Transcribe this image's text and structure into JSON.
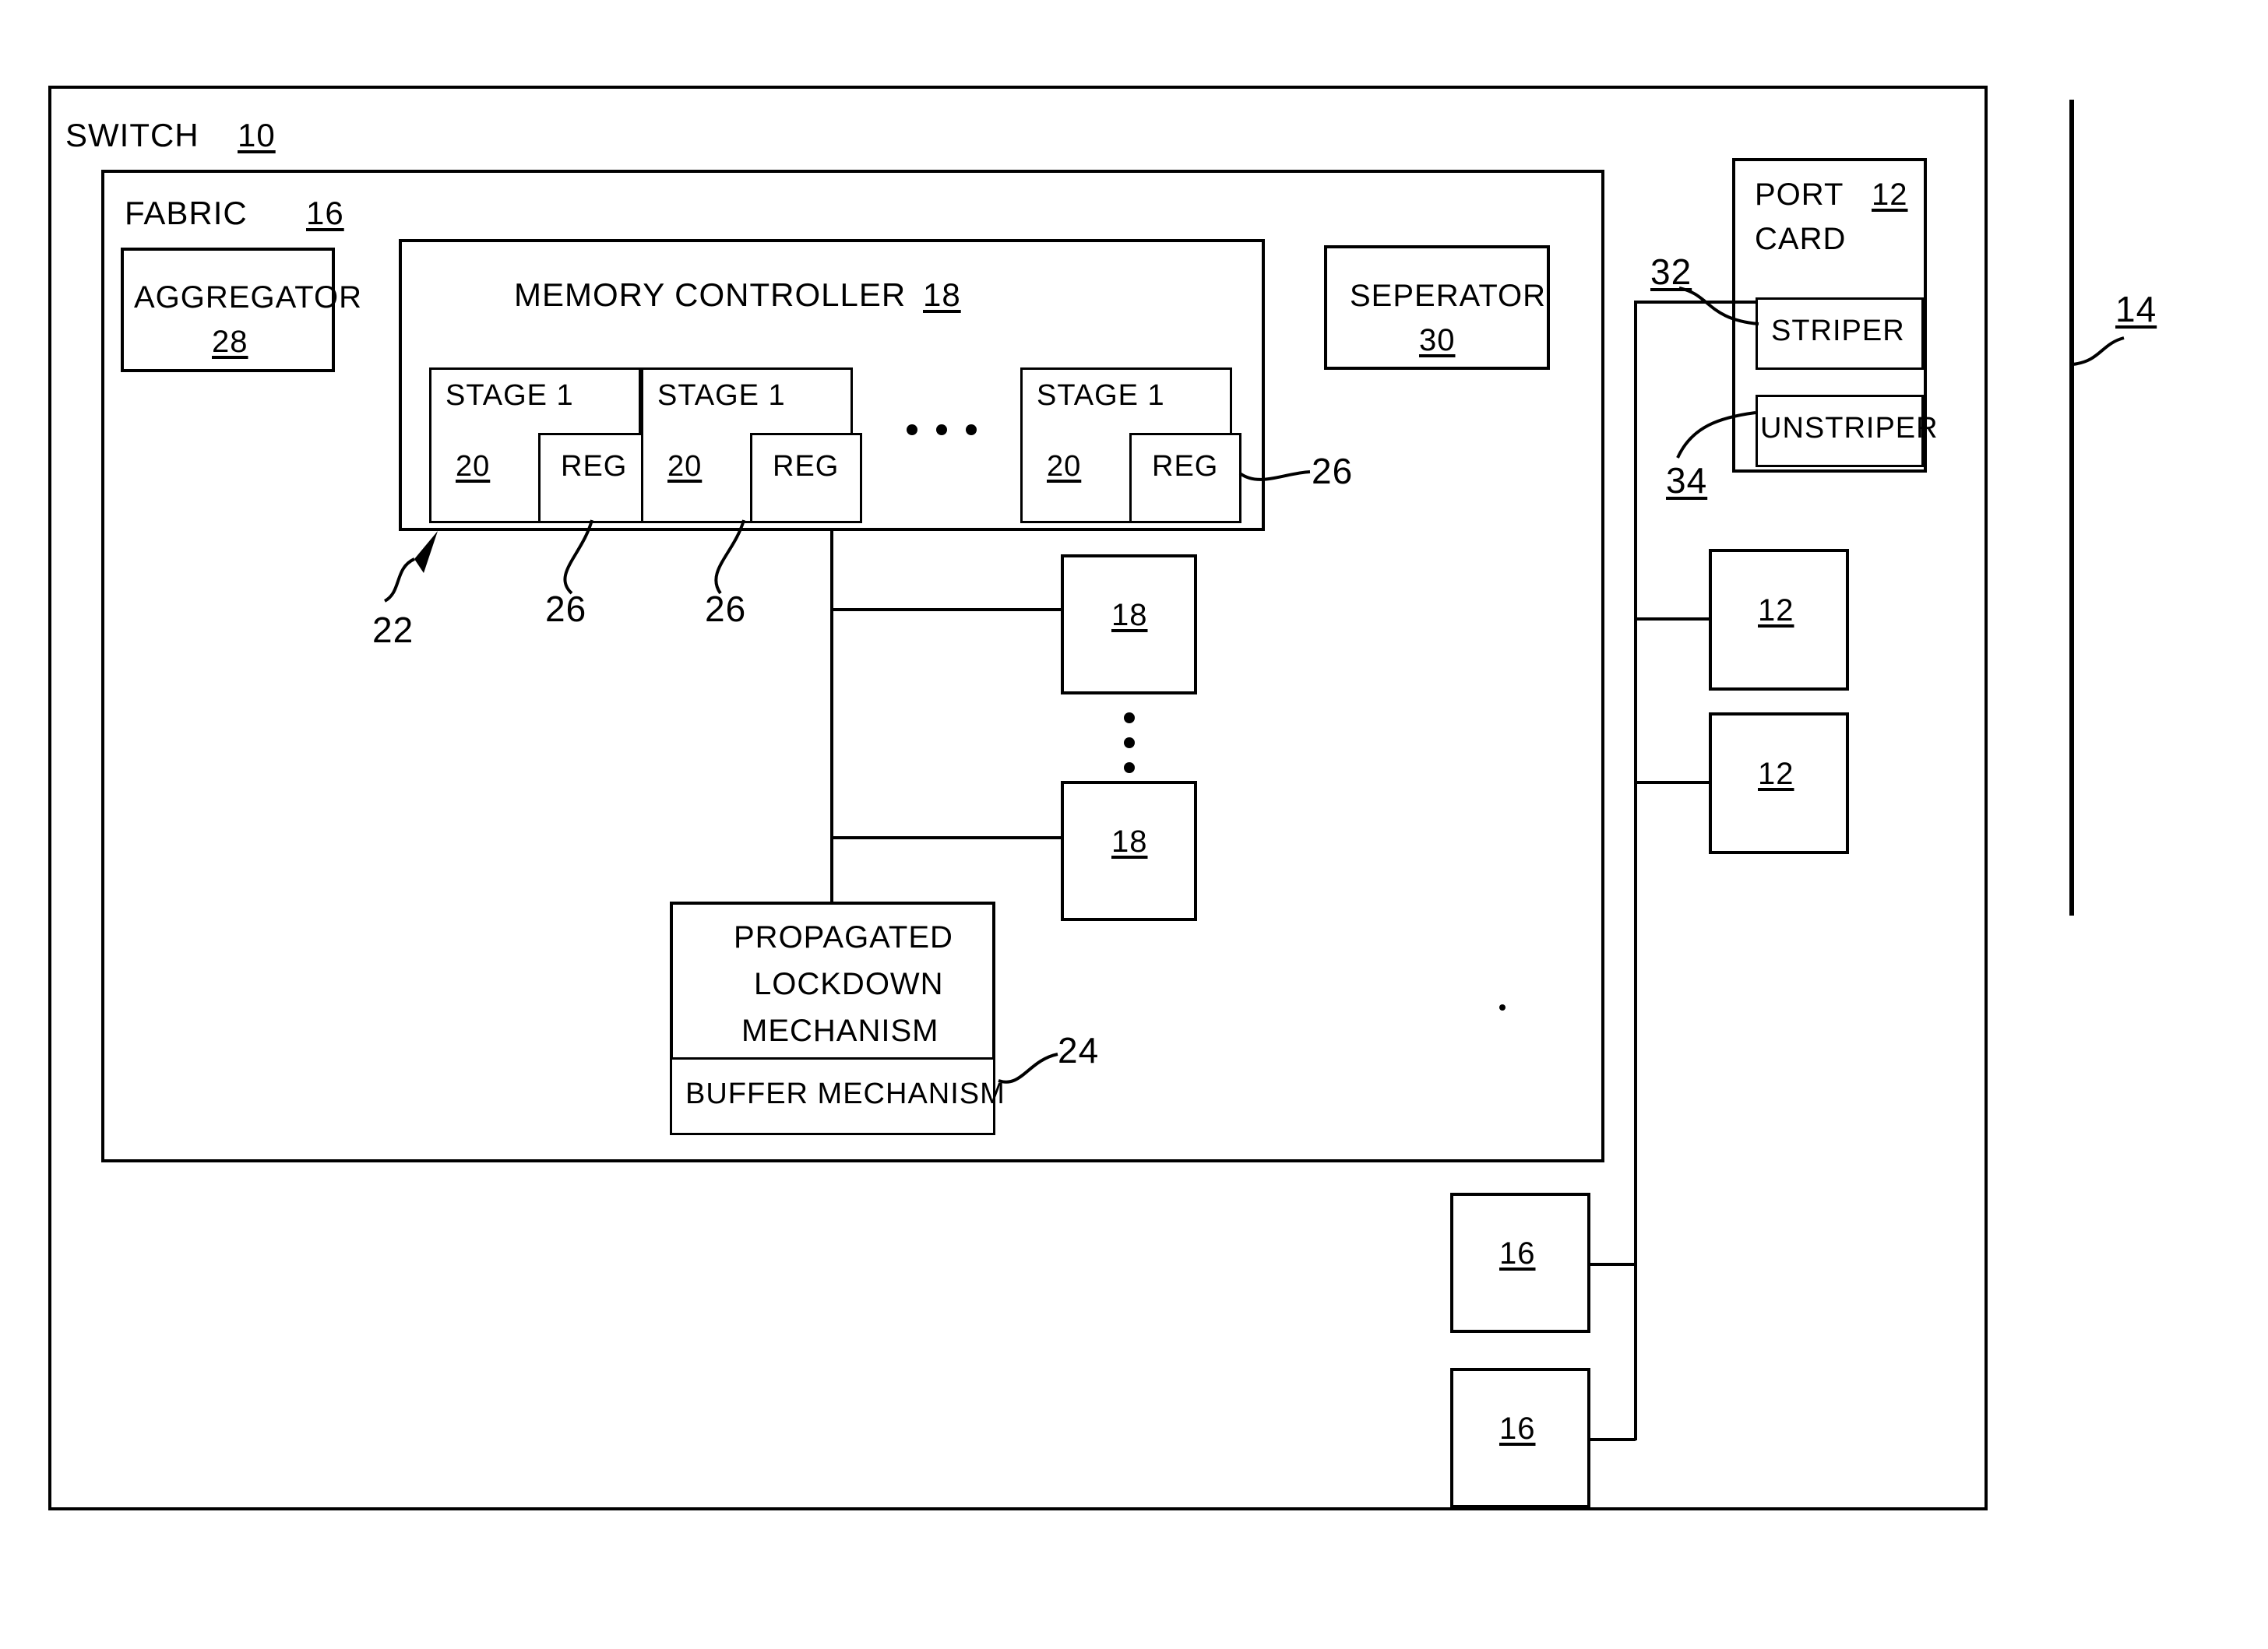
{
  "figure": {
    "type": "patent-block-diagram",
    "outer": {
      "label": "SWITCH",
      "ref": "10"
    },
    "fabric": {
      "label": "FABRIC",
      "ref": "16"
    },
    "aggregator": {
      "label": "AGGREGATOR",
      "ref": "28"
    },
    "seperator": {
      "label": "SEPERATOR",
      "ref": "30"
    },
    "memory_controller": {
      "label": "MEMORY CONTROLLER",
      "ref": "18",
      "ellipsis": "• • •",
      "stages": [
        {
          "title": "STAGE 1",
          "ref": "20",
          "reg": "REG"
        },
        {
          "title": "STAGE 1",
          "ref": "20",
          "reg": "REG"
        },
        {
          "title": "STAGE 1",
          "ref": "20",
          "reg": "REG"
        }
      ],
      "stage_lead_ref": "22",
      "reg_lead_refs": [
        "26",
        "26",
        "26"
      ]
    },
    "extra_memory_controllers": [
      {
        "ref": "18"
      },
      {
        "ref": "18"
      }
    ],
    "lockdown": {
      "line1": "PROPAGATED",
      "line2": "LOCKDOWN",
      "line3": "MECHANISM",
      "buffer": "BUFFER MECHANISM",
      "ref": "24"
    },
    "port_card": {
      "label_line1": "PORT",
      "label_line2": "CARD",
      "ref": "12",
      "striper": {
        "label": "STRIPER",
        "ref": "32"
      },
      "unstriper": {
        "label": "UNSTRIPER",
        "ref": "34"
      }
    },
    "port_cards": [
      {
        "ref": "12"
      },
      {
        "ref": "12"
      }
    ],
    "fabrics": [
      {
        "ref": "16"
      },
      {
        "ref": "16"
      }
    ],
    "network_line": {
      "ref": "14"
    }
  }
}
